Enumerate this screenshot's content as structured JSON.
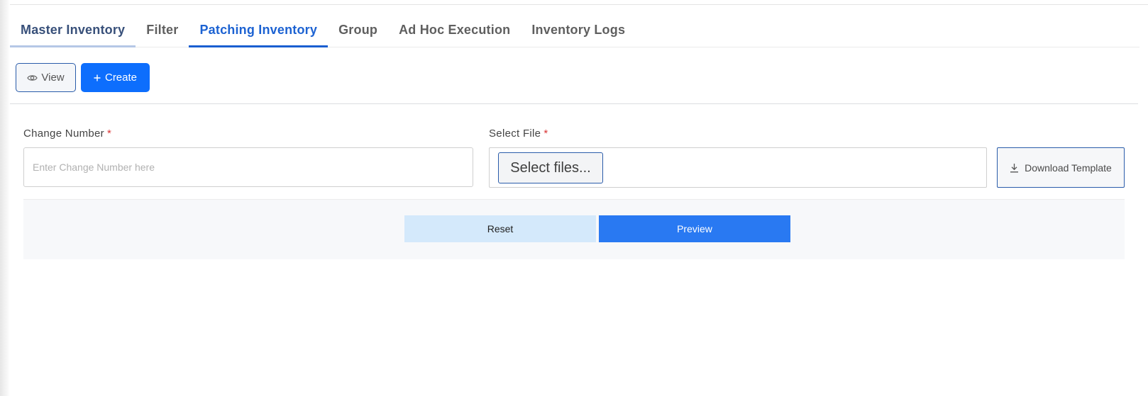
{
  "tabs": [
    {
      "label": "Master Inventory"
    },
    {
      "label": "Filter"
    },
    {
      "label": "Patching Inventory"
    },
    {
      "label": "Group"
    },
    {
      "label": "Ad Hoc Execution"
    },
    {
      "label": "Inventory Logs"
    }
  ],
  "active_tab": "Patching Inventory",
  "toolbar": {
    "view_label": "View",
    "view_icon": "eye-icon",
    "create_label": "Create",
    "create_icon": "plus-icon"
  },
  "form": {
    "change_number": {
      "label": "Change Number",
      "required_mark": "*",
      "placeholder": "Enter Change Number here",
      "value": ""
    },
    "select_file": {
      "label": "Select File",
      "required_mark": "*",
      "button_label": "Select files..."
    },
    "download_template": {
      "label": "Download Template",
      "icon": "download-icon"
    }
  },
  "actions": {
    "reset_label": "Reset",
    "preview_label": "Preview"
  },
  "colors": {
    "accent": "#0d6efd",
    "active_tab": "#1a5ed0",
    "preview_button": "#2979f2",
    "reset_button": "#d4e9fb",
    "required": "#d93636"
  }
}
